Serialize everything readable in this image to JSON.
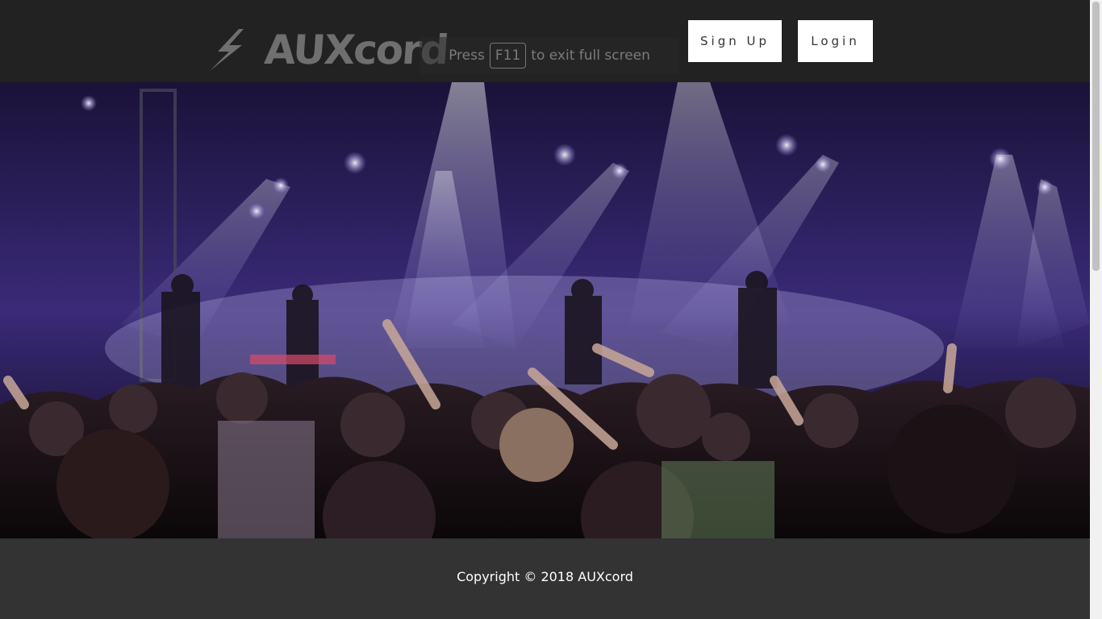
{
  "header": {
    "logo_text": "AUXcord",
    "signup_label": "Sign Up",
    "login_label": "Login"
  },
  "fullscreen_notice": {
    "prefix": "Press",
    "key": "F11",
    "suffix": "to exit full screen"
  },
  "hero": {
    "image": "concert crowd with stage lights",
    "icon": "lightning-bolt-icon"
  },
  "footer": {
    "copyright": "Copyright © 2018 AUXcord"
  },
  "colors": {
    "header_bg": "#222222",
    "footer_bg": "#333333",
    "button_bg": "#ffffff",
    "logo": "#6f6f6f"
  }
}
